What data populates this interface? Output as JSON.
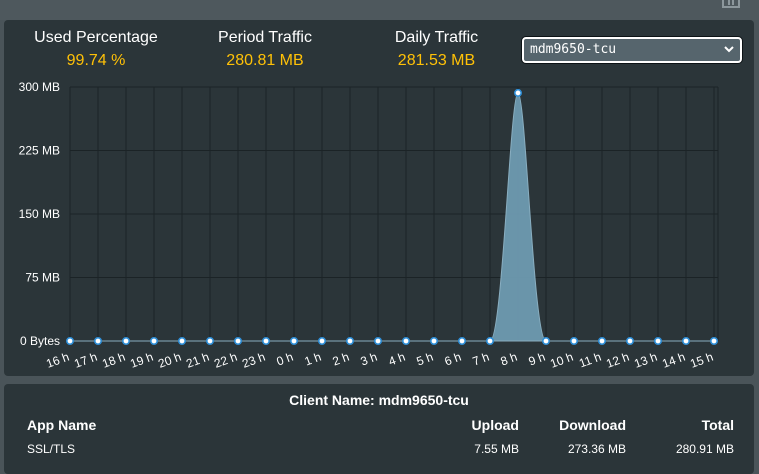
{
  "stats": [
    {
      "label": "Used Percentage",
      "value": "99.74 %"
    },
    {
      "label": "Period Traffic",
      "value": "280.81 MB"
    },
    {
      "label": "Daily Traffic",
      "value": "281.53 MB"
    }
  ],
  "device_select": {
    "selected": "mdm9650-tcu"
  },
  "chart_data": {
    "type": "area",
    "categories": [
      "16 h",
      "17 h",
      "18 h",
      "19 h",
      "20 h",
      "21 h",
      "22 h",
      "23 h",
      "0 h",
      "1 h",
      "2 h",
      "3 h",
      "4 h",
      "5 h",
      "6 h",
      "7 h",
      "8 h",
      "9 h",
      "10 h",
      "11 h",
      "12 h",
      "13 h",
      "14 h",
      "15 h"
    ],
    "series": [
      {
        "values": [
          0,
          0,
          0,
          0,
          0,
          0,
          0,
          0,
          0,
          0,
          0,
          0,
          0,
          0,
          0,
          0,
          293,
          0,
          0,
          0,
          0,
          0,
          0,
          0
        ]
      }
    ],
    "y_tick_labels": [
      "0 Bytes",
      "75 MB",
      "150 MB",
      "225 MB",
      "300 MB"
    ],
    "y_tick_values": [
      0,
      75,
      150,
      225,
      300
    ],
    "ylim": [
      0,
      300
    ],
    "grid": true,
    "colors": {
      "fill": "#6e9bb1",
      "point_stroke": "#2f8fd8",
      "point_fill": "#ffffff"
    }
  },
  "client_table": {
    "title": "Client Name: mdm9650-tcu",
    "headers": {
      "app": "App Name",
      "upload": "Upload",
      "download": "Download",
      "total": "Total"
    },
    "rows": [
      {
        "app": "SSL/TLS",
        "upload": "7.55 MB",
        "download": "273.36 MB",
        "total": "280.91 MB"
      }
    ]
  }
}
